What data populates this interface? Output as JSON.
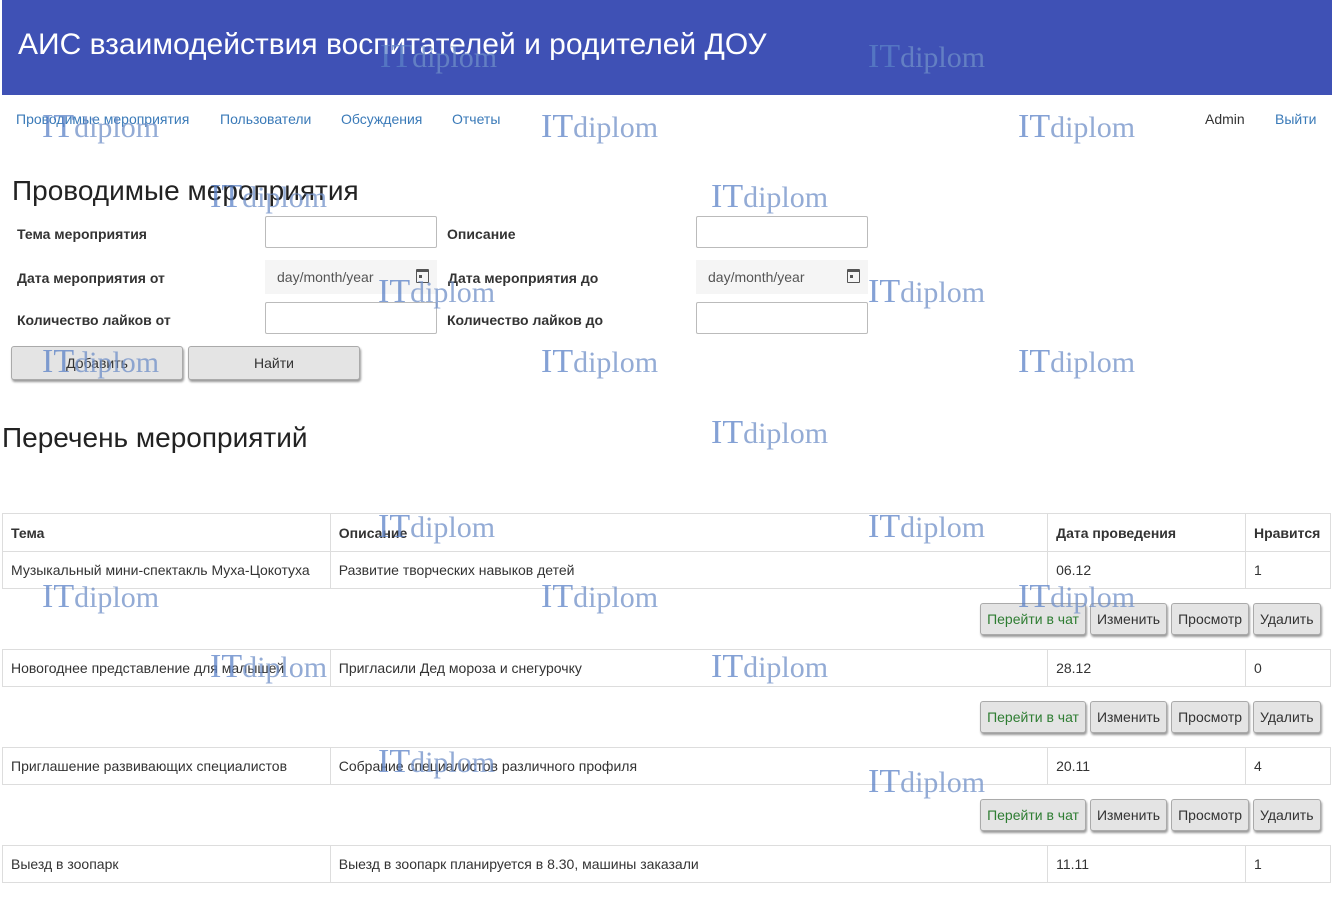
{
  "header": {
    "title": "АИС взаимодействия воспитателей и родителей ДОУ"
  },
  "nav": {
    "items": [
      {
        "label": "Проводимые мероприятия"
      },
      {
        "label": "Пользователи"
      },
      {
        "label": "Обсуждения"
      },
      {
        "label": "Отчеты"
      }
    ],
    "user": "Admin",
    "logout": "Выйти"
  },
  "filter": {
    "title": "Проводимые мероприятия",
    "topic_label": "Тема мероприятия",
    "topic_value": "",
    "description_label": "Описание",
    "description_value": "",
    "date_from_label": "Дата мероприятия от",
    "date_from_placeholder": "day/month/year",
    "date_to_label": "Дата мероприятия до",
    "date_to_placeholder": "day/month/year",
    "likes_from_label": "Количество лайков от",
    "likes_from_value": "",
    "likes_to_label": "Количество лайков до",
    "likes_to_value": "",
    "add_button": "Добавить",
    "find_button": "Найти"
  },
  "list": {
    "title": "Перечень мероприятий",
    "columns": [
      "Тема",
      "Описание",
      "Дата проведения",
      "Нравится"
    ],
    "rows": [
      {
        "topic": "Музыкальный мини-спектакль Муха-Цокотуха",
        "description": "Развитие творческих навыков детей",
        "date": "06.12",
        "likes": "1"
      },
      {
        "topic": "Новогоднее представление для малышей",
        "description": "Пригласили Дед мороза и снегурочку",
        "date": "28.12",
        "likes": "0"
      },
      {
        "topic": "Приглашение развивающих специалистов",
        "description": "Собрание специалистов различного профиля",
        "date": "20.11",
        "likes": "4"
      },
      {
        "topic": "Выезд в зоопарк",
        "description": "Выезд в зоопарк планируется в 8.30, машины заказали",
        "date": "11.11",
        "likes": "1"
      }
    ],
    "actions": {
      "chat": "Перейти в чат",
      "edit": "Изменить",
      "view": "Просмотр",
      "delete": "Удалить"
    }
  },
  "watermark": {
    "it": "IT",
    "rest": "diplom"
  }
}
